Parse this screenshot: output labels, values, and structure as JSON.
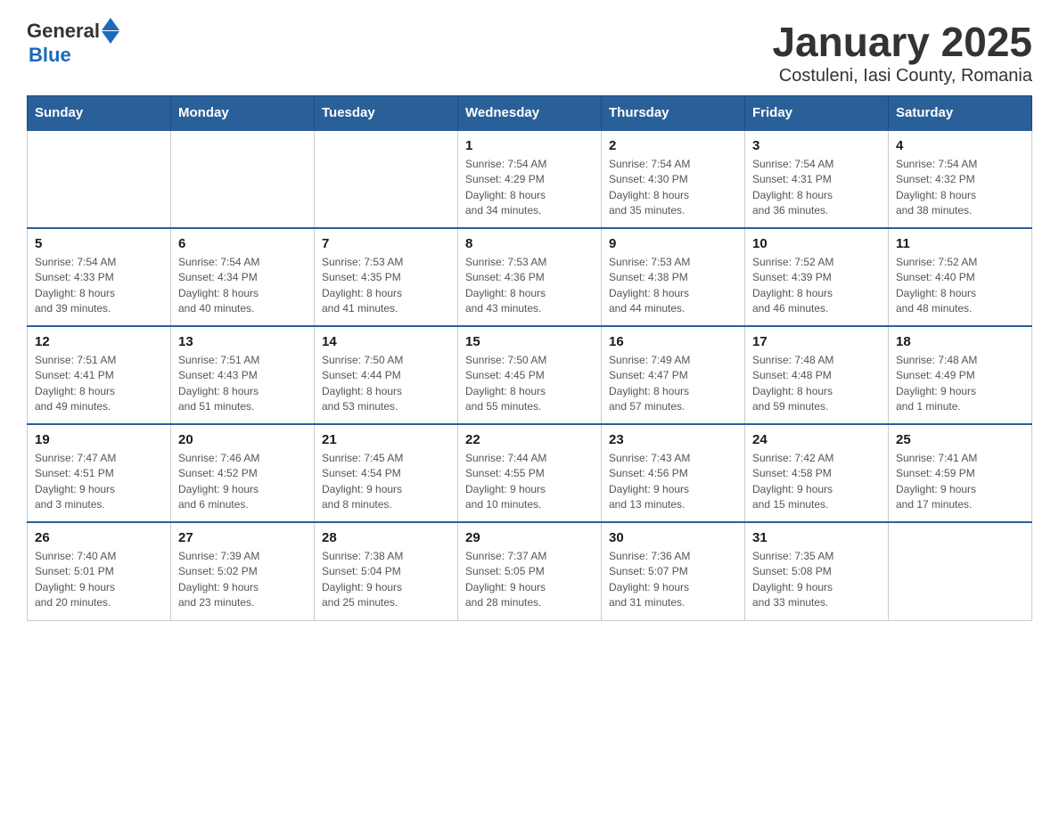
{
  "logo": {
    "general": "General",
    "blue": "Blue"
  },
  "title": "January 2025",
  "subtitle": "Costuleni, Iasi County, Romania",
  "days_of_week": [
    "Sunday",
    "Monday",
    "Tuesday",
    "Wednesday",
    "Thursday",
    "Friday",
    "Saturday"
  ],
  "weeks": [
    [
      {
        "day": "",
        "info": ""
      },
      {
        "day": "",
        "info": ""
      },
      {
        "day": "",
        "info": ""
      },
      {
        "day": "1",
        "info": "Sunrise: 7:54 AM\nSunset: 4:29 PM\nDaylight: 8 hours\nand 34 minutes."
      },
      {
        "day": "2",
        "info": "Sunrise: 7:54 AM\nSunset: 4:30 PM\nDaylight: 8 hours\nand 35 minutes."
      },
      {
        "day": "3",
        "info": "Sunrise: 7:54 AM\nSunset: 4:31 PM\nDaylight: 8 hours\nand 36 minutes."
      },
      {
        "day": "4",
        "info": "Sunrise: 7:54 AM\nSunset: 4:32 PM\nDaylight: 8 hours\nand 38 minutes."
      }
    ],
    [
      {
        "day": "5",
        "info": "Sunrise: 7:54 AM\nSunset: 4:33 PM\nDaylight: 8 hours\nand 39 minutes."
      },
      {
        "day": "6",
        "info": "Sunrise: 7:54 AM\nSunset: 4:34 PM\nDaylight: 8 hours\nand 40 minutes."
      },
      {
        "day": "7",
        "info": "Sunrise: 7:53 AM\nSunset: 4:35 PM\nDaylight: 8 hours\nand 41 minutes."
      },
      {
        "day": "8",
        "info": "Sunrise: 7:53 AM\nSunset: 4:36 PM\nDaylight: 8 hours\nand 43 minutes."
      },
      {
        "day": "9",
        "info": "Sunrise: 7:53 AM\nSunset: 4:38 PM\nDaylight: 8 hours\nand 44 minutes."
      },
      {
        "day": "10",
        "info": "Sunrise: 7:52 AM\nSunset: 4:39 PM\nDaylight: 8 hours\nand 46 minutes."
      },
      {
        "day": "11",
        "info": "Sunrise: 7:52 AM\nSunset: 4:40 PM\nDaylight: 8 hours\nand 48 minutes."
      }
    ],
    [
      {
        "day": "12",
        "info": "Sunrise: 7:51 AM\nSunset: 4:41 PM\nDaylight: 8 hours\nand 49 minutes."
      },
      {
        "day": "13",
        "info": "Sunrise: 7:51 AM\nSunset: 4:43 PM\nDaylight: 8 hours\nand 51 minutes."
      },
      {
        "day": "14",
        "info": "Sunrise: 7:50 AM\nSunset: 4:44 PM\nDaylight: 8 hours\nand 53 minutes."
      },
      {
        "day": "15",
        "info": "Sunrise: 7:50 AM\nSunset: 4:45 PM\nDaylight: 8 hours\nand 55 minutes."
      },
      {
        "day": "16",
        "info": "Sunrise: 7:49 AM\nSunset: 4:47 PM\nDaylight: 8 hours\nand 57 minutes."
      },
      {
        "day": "17",
        "info": "Sunrise: 7:48 AM\nSunset: 4:48 PM\nDaylight: 8 hours\nand 59 minutes."
      },
      {
        "day": "18",
        "info": "Sunrise: 7:48 AM\nSunset: 4:49 PM\nDaylight: 9 hours\nand 1 minute."
      }
    ],
    [
      {
        "day": "19",
        "info": "Sunrise: 7:47 AM\nSunset: 4:51 PM\nDaylight: 9 hours\nand 3 minutes."
      },
      {
        "day": "20",
        "info": "Sunrise: 7:46 AM\nSunset: 4:52 PM\nDaylight: 9 hours\nand 6 minutes."
      },
      {
        "day": "21",
        "info": "Sunrise: 7:45 AM\nSunset: 4:54 PM\nDaylight: 9 hours\nand 8 minutes."
      },
      {
        "day": "22",
        "info": "Sunrise: 7:44 AM\nSunset: 4:55 PM\nDaylight: 9 hours\nand 10 minutes."
      },
      {
        "day": "23",
        "info": "Sunrise: 7:43 AM\nSunset: 4:56 PM\nDaylight: 9 hours\nand 13 minutes."
      },
      {
        "day": "24",
        "info": "Sunrise: 7:42 AM\nSunset: 4:58 PM\nDaylight: 9 hours\nand 15 minutes."
      },
      {
        "day": "25",
        "info": "Sunrise: 7:41 AM\nSunset: 4:59 PM\nDaylight: 9 hours\nand 17 minutes."
      }
    ],
    [
      {
        "day": "26",
        "info": "Sunrise: 7:40 AM\nSunset: 5:01 PM\nDaylight: 9 hours\nand 20 minutes."
      },
      {
        "day": "27",
        "info": "Sunrise: 7:39 AM\nSunset: 5:02 PM\nDaylight: 9 hours\nand 23 minutes."
      },
      {
        "day": "28",
        "info": "Sunrise: 7:38 AM\nSunset: 5:04 PM\nDaylight: 9 hours\nand 25 minutes."
      },
      {
        "day": "29",
        "info": "Sunrise: 7:37 AM\nSunset: 5:05 PM\nDaylight: 9 hours\nand 28 minutes."
      },
      {
        "day": "30",
        "info": "Sunrise: 7:36 AM\nSunset: 5:07 PM\nDaylight: 9 hours\nand 31 minutes."
      },
      {
        "day": "31",
        "info": "Sunrise: 7:35 AM\nSunset: 5:08 PM\nDaylight: 9 hours\nand 33 minutes."
      },
      {
        "day": "",
        "info": ""
      }
    ]
  ]
}
